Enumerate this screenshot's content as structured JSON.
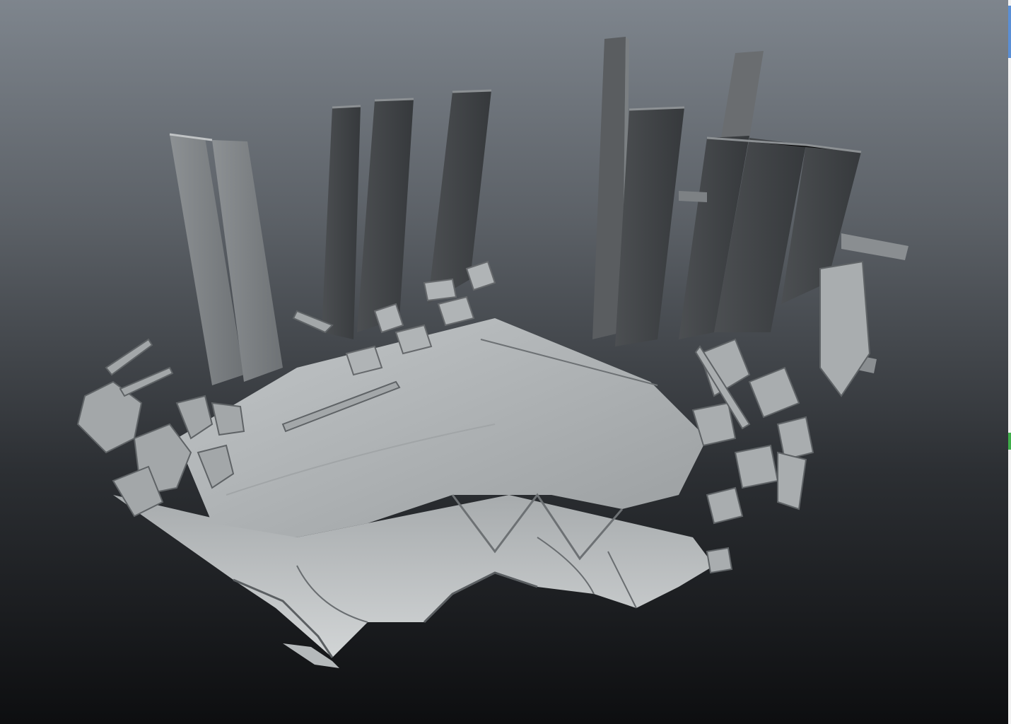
{
  "app": {
    "view": "3d-viewport",
    "object": "ruined-room-sculpt"
  },
  "colors": {
    "background_top": "#7e858d",
    "background_bottom": "#0d0e10",
    "mesh_light": "#b9bdbf",
    "mesh_mid": "#8e9395",
    "mesh_dark": "#4a4d50",
    "plank_dark": "#3f4245",
    "ui_edge": "#f2f2f2",
    "ui_edge_blue": "#5a8fd6",
    "ui_edge_green": "#3fae4a"
  }
}
